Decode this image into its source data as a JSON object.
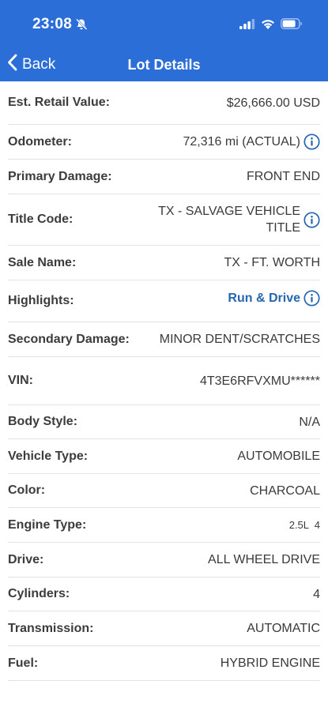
{
  "status_bar": {
    "time": "23:08"
  },
  "nav": {
    "back_label": "Back",
    "title": "Lot Details"
  },
  "colors": {
    "header": "#2c6ed8",
    "link": "#2566b0"
  },
  "rows": [
    {
      "label": "Est. Retail Value:",
      "value": "$26,666.00 USD"
    },
    {
      "label": "Odometer:",
      "value": "72,316 mi (ACTUAL)",
      "info": true
    },
    {
      "label": "Primary Damage:",
      "value": "FRONT END"
    },
    {
      "label": "Title Code:",
      "value_line1": "TX - SALVAGE VEHICLE",
      "value_line2": "TITLE",
      "info": true
    },
    {
      "label": "Sale Name:",
      "value": "TX - FT. WORTH"
    },
    {
      "label": "Highlights:",
      "value": "Run & Drive",
      "info": true
    },
    {
      "label": "Secondary Damage:",
      "value": "MINOR DENT/SCRATCHES"
    },
    {
      "label": "VIN:",
      "value": "4T3E6RFVXMU******"
    },
    {
      "label": "Body Style:",
      "value": "N/A"
    },
    {
      "label": "Vehicle Type:",
      "value": "AUTOMOBILE"
    },
    {
      "label": "Color:",
      "value": "CHARCOAL"
    },
    {
      "label": "Engine Type:",
      "value": "2.5L  4"
    },
    {
      "label": "Drive:",
      "value": "ALL WHEEL DRIVE"
    },
    {
      "label": "Cylinders:",
      "value": "4"
    },
    {
      "label": "Transmission:",
      "value": "AUTOMATIC"
    },
    {
      "label": "Fuel:",
      "value": "HYBRID ENGINE"
    }
  ]
}
